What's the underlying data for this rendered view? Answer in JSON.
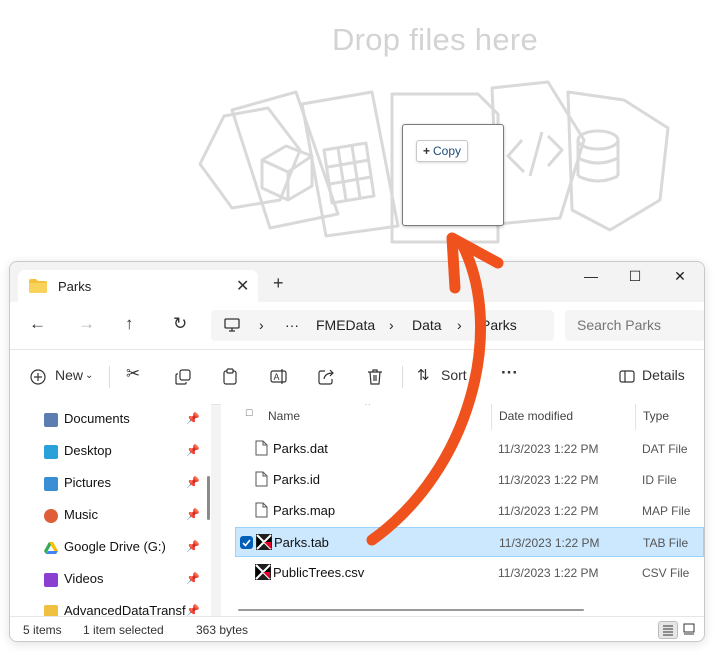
{
  "drop_zone": {
    "title": "Drop files here",
    "copy_badge": "Copy"
  },
  "window": {
    "tab_title": "Parks",
    "new_tab": "+",
    "controls": {
      "minimize": "—",
      "maximize": "☐",
      "close": "✕"
    },
    "breadcrumb": {
      "more": "···",
      "items": [
        "FMEData",
        "Data",
        "Parks"
      ]
    },
    "search_placeholder": "Search Parks",
    "toolbar": {
      "new_label": "New",
      "sort_label": "Sort",
      "more": "···",
      "details_label": "Details"
    },
    "sidebar": [
      {
        "label": "Documents",
        "icon": "documents-icon",
        "color": "#5b7db1"
      },
      {
        "label": "Desktop",
        "icon": "desktop-icon",
        "color": "#2aa1d8"
      },
      {
        "label": "Pictures",
        "icon": "pictures-icon",
        "color": "#3a8ed3"
      },
      {
        "label": "Music",
        "icon": "music-icon",
        "color": "#e05d3a"
      },
      {
        "label": "Google Drive (G:)",
        "icon": "google-drive-icon",
        "color": "#34a853"
      },
      {
        "label": "Videos",
        "icon": "videos-icon",
        "color": "#8b3fd1"
      },
      {
        "label": "AdvancedDataTransfor",
        "icon": "folder-icon",
        "color": "#f0c040"
      }
    ],
    "columns": {
      "name": "Name",
      "date": "Date modified",
      "type": "Type"
    },
    "files": [
      {
        "name": "Parks.dat",
        "date": "11/3/2023 1:22 PM",
        "type": "DAT File",
        "icon": "file-icon",
        "selected": false
      },
      {
        "name": "Parks.id",
        "date": "11/3/2023 1:22 PM",
        "type": "ID File",
        "icon": "file-icon",
        "selected": false
      },
      {
        "name": "Parks.map",
        "date": "11/3/2023 1:22 PM",
        "type": "MAP File",
        "icon": "file-icon",
        "selected": false
      },
      {
        "name": "Parks.tab",
        "date": "11/3/2023 1:22 PM",
        "type": "TAB File",
        "icon": "fme-file-icon",
        "selected": true
      },
      {
        "name": "PublicTrees.csv",
        "date": "11/3/2023 1:22 PM",
        "type": "CSV File",
        "icon": "fme-file-icon",
        "selected": false
      }
    ],
    "status": {
      "items": "5 items",
      "selected": "1 item selected",
      "size": "363 bytes"
    }
  },
  "colors": {
    "accent": "#005fb8",
    "arrow": "#f0521e",
    "selection": "#cce8ff"
  }
}
